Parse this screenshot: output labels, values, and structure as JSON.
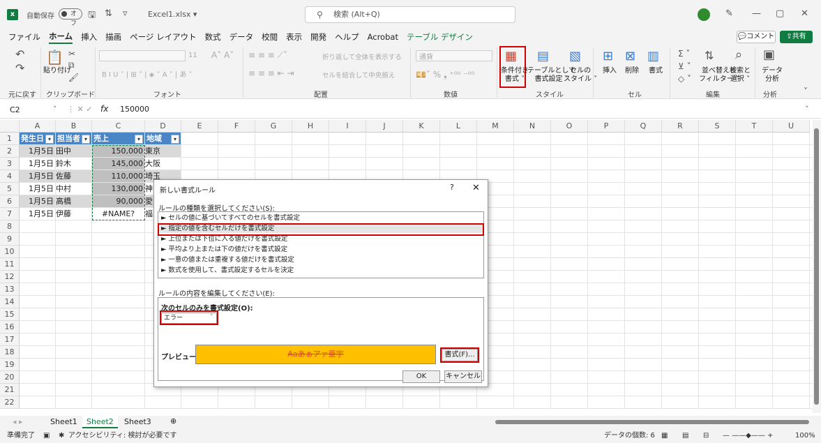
{
  "title_bar": {
    "autosave": "自動保存",
    "toggle": "オフ",
    "filename": "Excel1.xlsx ▾",
    "search": "検索 (Alt+Q)"
  },
  "menu": [
    "ファイル",
    "ホーム",
    "挿入",
    "描画",
    "ページ レイアウト",
    "数式",
    "データ",
    "校閲",
    "表示",
    "開発",
    "ヘルプ",
    "Acrobat",
    "テーブル デザイン"
  ],
  "comment": "コメント",
  "share": "共有",
  "ribbon": {
    "undo_group": "元に戻す",
    "clipboard_group": "クリップボード",
    "paste": "貼り付け",
    "font_group": "フォント",
    "font_size": "11",
    "align_group": "配置",
    "wrap": "折り返して全体を表示する",
    "merge": "セルを結合して中央揃え",
    "number_group": "数値",
    "number_format": "通貨",
    "style_group": "スタイル",
    "cond_format": "条件付き\n書式 ˅",
    "table_format": "テーブルとして\n書式設定 ˅",
    "cell_style": "セルの\nスタイル ˅",
    "cells_group": "セル",
    "insert": "挿入",
    "delete": "削除",
    "format": "書式",
    "edit_group": "編集",
    "sort": "並べ替えと\nフィルター ˅",
    "find": "検索と\n選択 ˅",
    "analysis_group": "分析",
    "analyze": "データ\n分析"
  },
  "formula_bar": {
    "cell": "C2",
    "value": "150000"
  },
  "columns": [
    "A",
    "B",
    "C",
    "D",
    "E",
    "F",
    "G",
    "H",
    "I",
    "J",
    "K",
    "L",
    "M",
    "N",
    "O",
    "P",
    "Q",
    "R",
    "S",
    "T",
    "U"
  ],
  "rows": [
    "1",
    "2",
    "3",
    "4",
    "5",
    "6",
    "7",
    "8",
    "9",
    "10",
    "11",
    "12",
    "13",
    "14",
    "15",
    "16",
    "17",
    "18",
    "19",
    "20",
    "21",
    "22"
  ],
  "table": {
    "headers": [
      "発生日",
      "担当者",
      "売上",
      "地域"
    ],
    "data": [
      [
        "1月5日",
        "田中",
        "150,000",
        "東京"
      ],
      [
        "1月5日",
        "鈴木",
        "145,000",
        "大阪"
      ],
      [
        "1月5日",
        "佐藤",
        "110,000",
        "埼玉"
      ],
      [
        "1月5日",
        "中村",
        "130,000",
        "神"
      ],
      [
        "1月5日",
        "高橋",
        "90,000",
        "愛"
      ],
      [
        "1月5日",
        "伊藤",
        "#NAME?",
        "福"
      ]
    ]
  },
  "sheets": [
    "Sheet1",
    "Sheet2",
    "Sheet3"
  ],
  "status": {
    "ready": "準備完了",
    "accessibility": "アクセシビリティ: 検討が必要です",
    "count": "データの個数: 6",
    "zoom": "100%"
  },
  "dialog": {
    "title": "新しい書式ルール",
    "help": "?",
    "close": "✕",
    "rule_type_label": "ルールの種類を選択してください(S):",
    "rule_types": [
      "► セルの値に基づいてすべてのセルを書式設定",
      "► 指定の値を含むセルだけを書式設定",
      "► 上位または下位に入る値だけを書式設定",
      "► 平均より上または下の値だけを書式設定",
      "► 一意の値または重複する値だけを書式設定",
      "► 数式を使用して、書式設定するセルを決定"
    ],
    "edit_label": "ルールの内容を編集してください(E):",
    "only_label": "次のセルのみを書式設定(O):",
    "dropdown_value": "エラー",
    "preview_label": "プレビュー:",
    "preview_text": "Aaあぁアァ亜宇",
    "format_btn": "書式(F)...",
    "ok": "OK",
    "cancel": "キャンセル"
  }
}
